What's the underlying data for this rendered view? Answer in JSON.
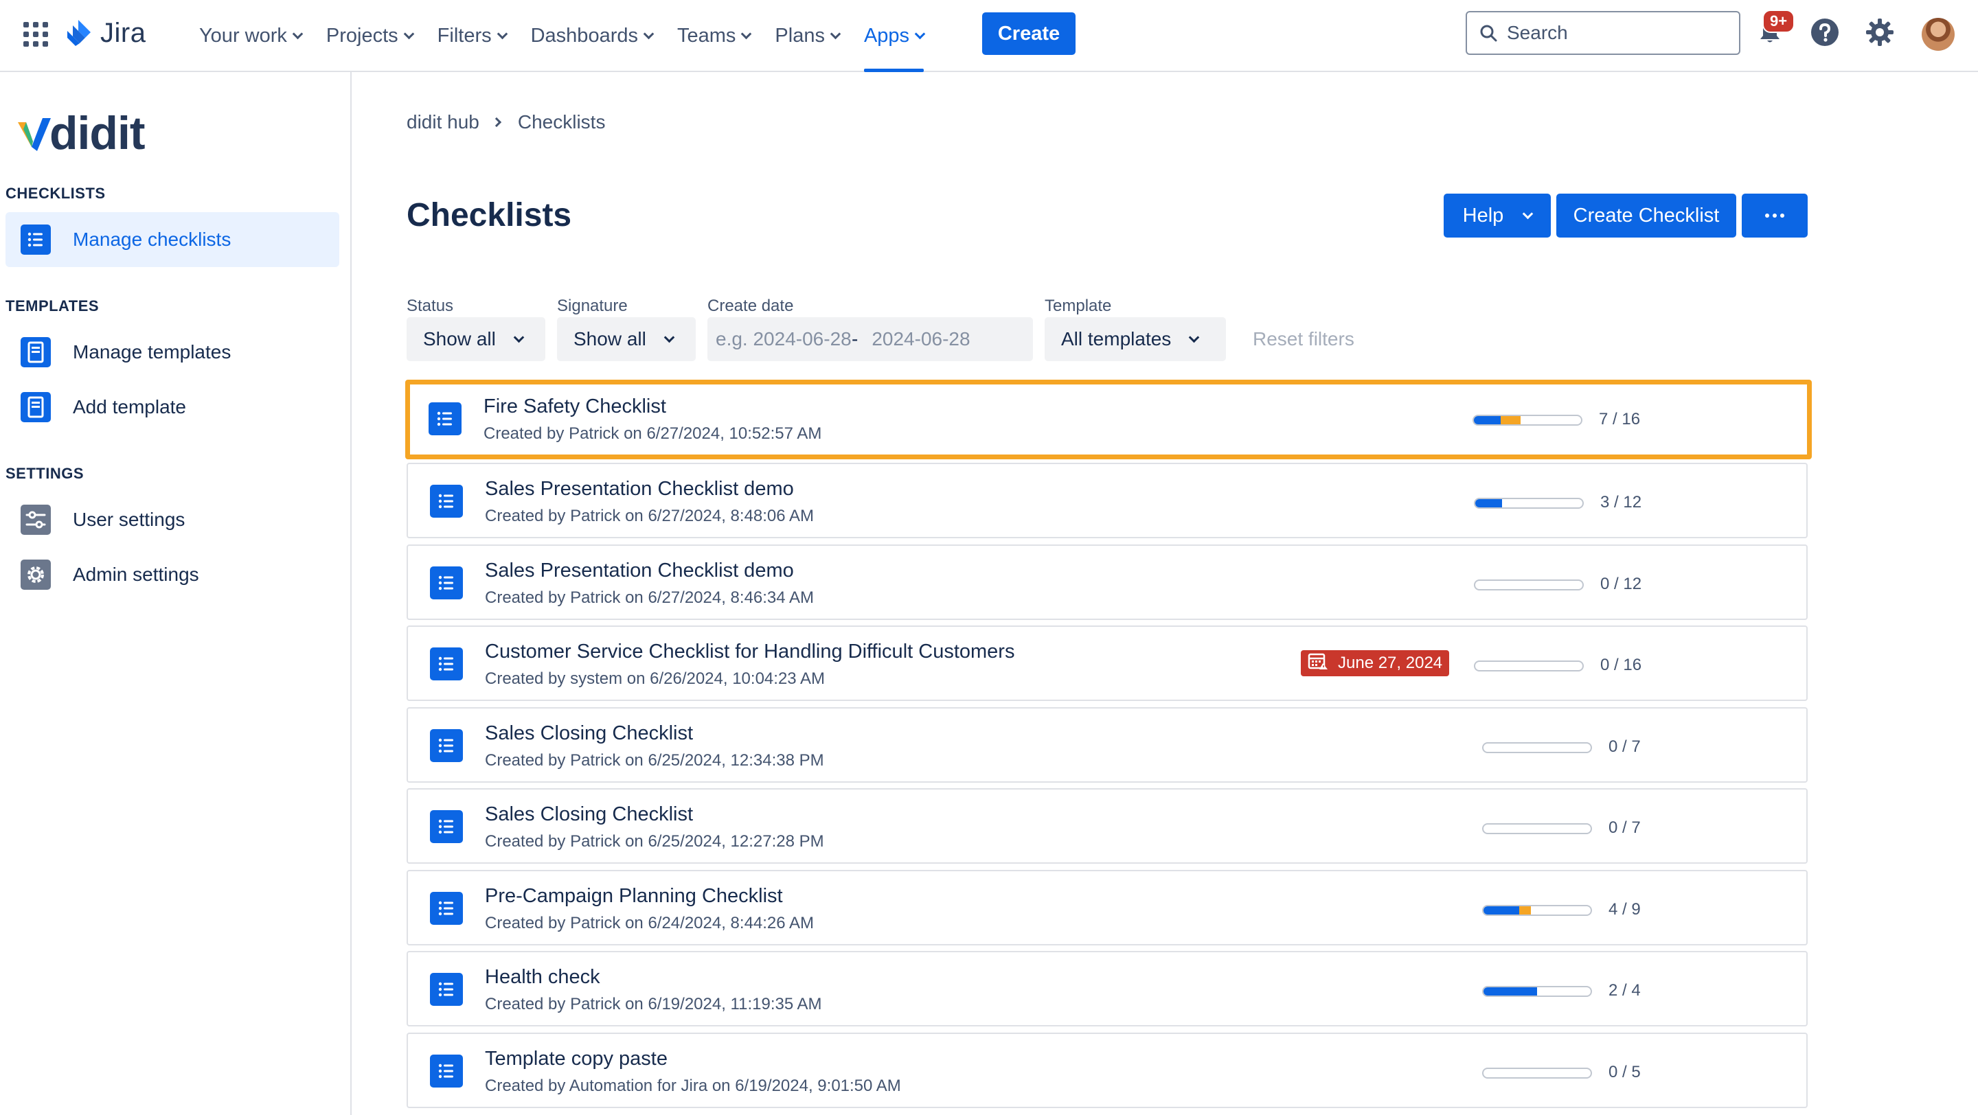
{
  "topnav": {
    "product": "Jira",
    "items": [
      {
        "label": "Your work"
      },
      {
        "label": "Projects"
      },
      {
        "label": "Filters"
      },
      {
        "label": "Dashboards"
      },
      {
        "label": "Teams"
      },
      {
        "label": "Plans"
      },
      {
        "label": "Apps",
        "active": true
      }
    ],
    "create_label": "Create",
    "search_placeholder": "Search",
    "notification_badge": "9+"
  },
  "sidebar": {
    "brand": "didit",
    "sections": [
      {
        "heading": "CHECKLISTS",
        "items": [
          {
            "label": "Manage checklists",
            "icon": "list-icon",
            "selected": true
          }
        ]
      },
      {
        "heading": "TEMPLATES",
        "items": [
          {
            "label": "Manage templates",
            "icon": "document-icon"
          },
          {
            "label": "Add template",
            "icon": "document-icon"
          }
        ]
      },
      {
        "heading": "SETTINGS",
        "items": [
          {
            "label": "User settings",
            "icon": "sliders-icon"
          },
          {
            "label": "Admin settings",
            "icon": "gear-icon"
          }
        ]
      }
    ]
  },
  "main": {
    "breadcrumb": [
      "didit hub",
      "Checklists"
    ],
    "title": "Checklists",
    "buttons": {
      "help": "Help",
      "create": "Create Checklist"
    },
    "filters": {
      "status": {
        "label": "Status",
        "value": "Show all"
      },
      "signature": {
        "label": "Signature",
        "value": "Show all"
      },
      "create_date": {
        "label": "Create date",
        "from_placeholder": "e.g. 2024-06-28",
        "separator": "-",
        "to_placeholder": "2024-06-28"
      },
      "template": {
        "label": "Template",
        "value": "All templates"
      },
      "reset_label": "Reset filters"
    },
    "checklists": [
      {
        "title": "Fire Safety Checklist",
        "subtitle": "Created by Patrick on 6/27/2024, 10:52:57 AM",
        "done": 4,
        "partial": 3,
        "total": 16,
        "count": "7 / 16",
        "highlight": true
      },
      {
        "title": "Sales Presentation Checklist demo",
        "subtitle": "Created by Patrick on 6/27/2024, 8:48:06 AM",
        "done": 3,
        "partial": 0,
        "total": 12,
        "count": "3 / 12"
      },
      {
        "title": "Sales Presentation Checklist demo",
        "subtitle": "Created by Patrick on 6/27/2024, 8:46:34 AM",
        "done": 0,
        "partial": 0,
        "total": 12,
        "count": "0 / 12"
      },
      {
        "title": "Customer Service Checklist for Handling Difficult Customers",
        "subtitle": "Created by system on 6/26/2024, 10:04:23 AM",
        "done": 0,
        "partial": 0,
        "total": 16,
        "count": "0 / 16",
        "due": "June 27, 2024"
      },
      {
        "title": "Sales Closing Checklist",
        "subtitle": "Created by Patrick on 6/25/2024, 12:34:38 PM",
        "done": 0,
        "partial": 0,
        "total": 7,
        "count": "0 / 7"
      },
      {
        "title": "Sales Closing Checklist",
        "subtitle": "Created by Patrick on 6/25/2024, 12:27:28 PM",
        "done": 0,
        "partial": 0,
        "total": 7,
        "count": "0 / 7"
      },
      {
        "title": "Pre-Campaign Planning Checklist",
        "subtitle": "Created by Patrick on 6/24/2024, 8:44:26 AM",
        "done": 3,
        "partial": 1,
        "total": 9,
        "count": "4 / 9"
      },
      {
        "title": "Health check",
        "subtitle": "Created by Patrick on 6/19/2024, 11:19:35 AM",
        "done": 2,
        "partial": 0,
        "total": 4,
        "count": "2 / 4"
      },
      {
        "title": "Template copy paste",
        "subtitle": "Created by Automation for Jira on 6/19/2024, 9:01:50 AM",
        "done": 0,
        "partial": 0,
        "total": 5,
        "count": "0 / 5"
      }
    ]
  },
  "colors": {
    "primary": "#0c66e4",
    "highlight": "#f5a524",
    "danger": "#c9372c",
    "text": "#172b4d",
    "subtle": "#44546f"
  }
}
